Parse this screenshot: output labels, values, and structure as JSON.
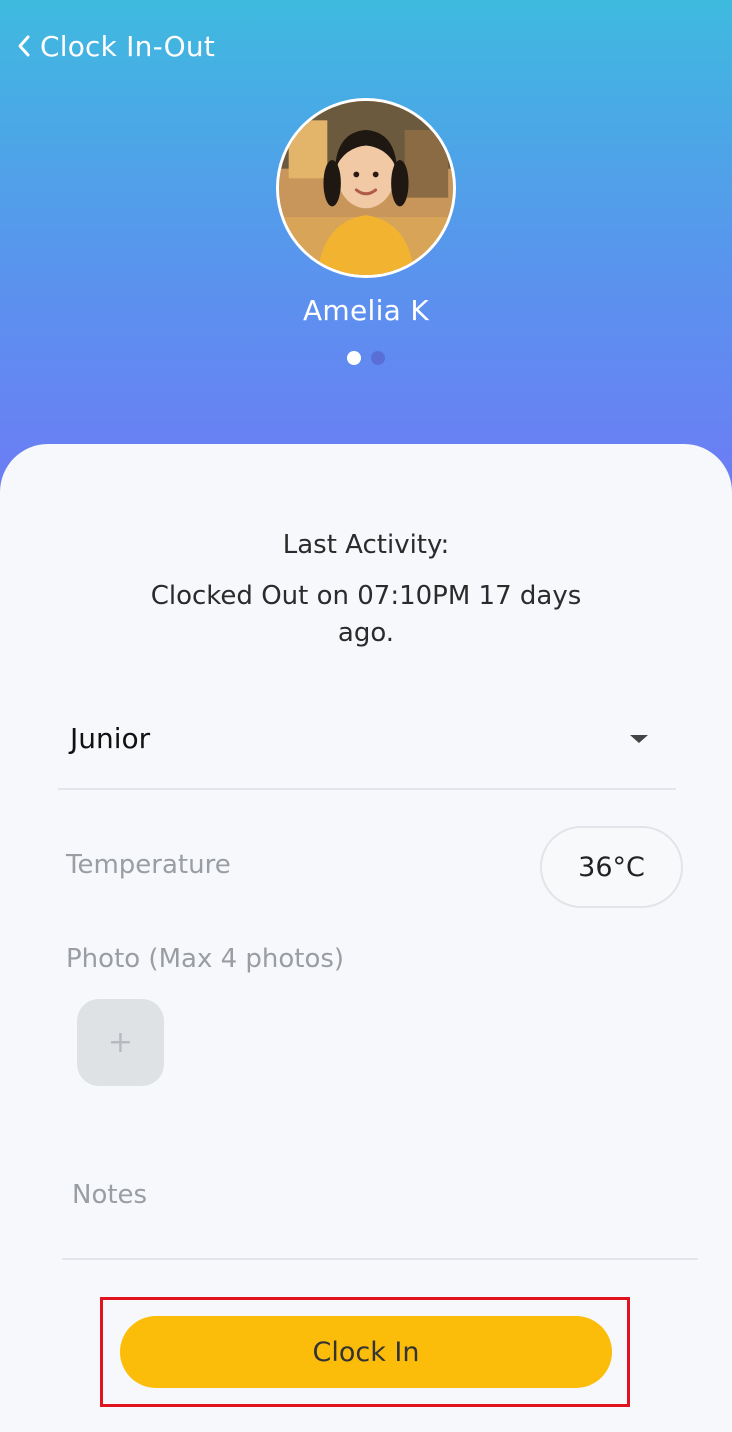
{
  "header": {
    "title": "Clock In-Out",
    "child_name": "Amelia K",
    "pager": {
      "total": 2,
      "active": 1
    }
  },
  "activity": {
    "label": "Last Activity:",
    "detail": "Clocked Out on 07:10PM 17 days ago."
  },
  "form": {
    "class_selected": "Junior",
    "temperature_label": "Temperature",
    "temperature_value": "36°C",
    "photo_label": "Photo (Max 4 photos)",
    "add_photo_symbol": "+",
    "notes_placeholder": "Notes"
  },
  "actions": {
    "clock_in_label": "Clock In"
  },
  "icons": {
    "back": "chevron-left-icon",
    "dropdown": "caret-down-icon",
    "add": "plus-icon"
  },
  "colors": {
    "header_gradient_top": "#3ebadf",
    "header_gradient_bottom": "#6d7bf5",
    "primary_button": "#fbbd0a",
    "highlight_border": "#e0141e"
  }
}
